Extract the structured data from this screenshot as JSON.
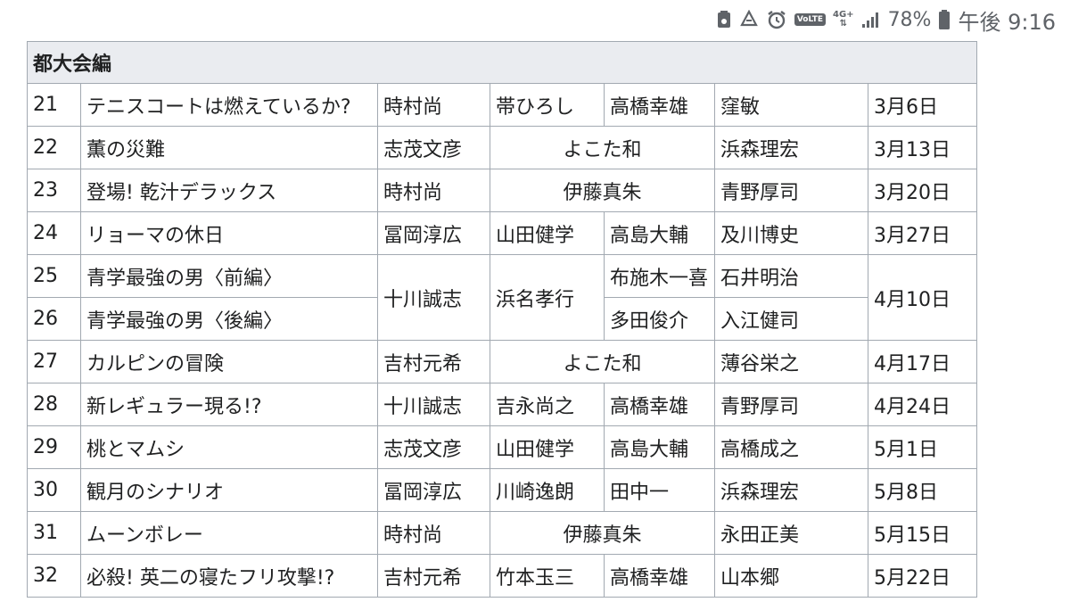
{
  "status_bar": {
    "volte": "VoLTE",
    "network": "4G+",
    "battery": "78%",
    "time": "午後 9:16"
  },
  "table": {
    "section_title": "都大会編",
    "rows": [
      {
        "no": "21",
        "title": "テニスコートは燃えているか?",
        "script": "時村尚",
        "storyboard": "帯ひろし",
        "director": "高橋幸雄",
        "animation": "窪敏",
        "date": "3月6日"
      },
      {
        "no": "22",
        "title": "薫の災難",
        "script": "志茂文彦",
        "storyboard_director": "よこた和",
        "animation": "浜森理宏",
        "date": "3月13日"
      },
      {
        "no": "23",
        "title": "登場! 乾汁デラックス",
        "script": "時村尚",
        "storyboard_director": "伊藤真朱",
        "animation": "青野厚司",
        "date": "3月20日"
      },
      {
        "no": "24",
        "title": "リョーマの休日",
        "script": "冨岡淳広",
        "storyboard": "山田健学",
        "director": "高島大輔",
        "animation": "及川博史",
        "date": "3月27日"
      },
      {
        "no": "25",
        "title": "青学最強の男〈前編〉",
        "director": "布施木一喜",
        "animation": "石井明治"
      },
      {
        "no": "26",
        "title": "青学最強の男〈後編〉",
        "director": "多田俊介",
        "animation": "入江健司"
      },
      {
        "no": "27",
        "title": "カルピンの冒険",
        "script": "吉村元希",
        "storyboard_director": "よこた和",
        "animation": "薄谷栄之",
        "date": "4月17日"
      },
      {
        "no": "28",
        "title": "新レギュラー現る!?",
        "script": "十川誠志",
        "storyboard": "吉永尚之",
        "director": "高橋幸雄",
        "animation": "青野厚司",
        "date": "4月24日"
      },
      {
        "no": "29",
        "title": "桃とマムシ",
        "script": "志茂文彦",
        "storyboard": "山田健学",
        "director": "高島大輔",
        "animation": "高橋成之",
        "date": "5月1日"
      },
      {
        "no": "30",
        "title": "観月のシナリオ",
        "script": "冨岡淳広",
        "storyboard": "川崎逸朗",
        "director": "田中一",
        "animation": "浜森理宏",
        "date": "5月8日"
      },
      {
        "no": "31",
        "title": "ムーンボレー",
        "script": "時村尚",
        "storyboard_director": "伊藤真朱",
        "animation": "永田正美",
        "date": "5月15日"
      },
      {
        "no": "32",
        "title": "必殺! 英二の寝たフリ攻撃!?",
        "script": "吉村元希",
        "storyboard": "竹本玉三",
        "director": "高橋幸雄",
        "animation": "山本郷",
        "date": "5月22日"
      }
    ],
    "shared_25_26": {
      "script": "十川誠志",
      "storyboard": "浜名孝行",
      "date": "4月10日"
    }
  }
}
